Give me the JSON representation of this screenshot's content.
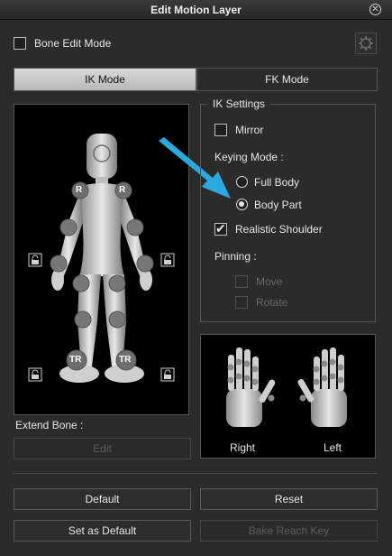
{
  "window": {
    "title": "Edit Motion Layer",
    "close_icon": "close-icon"
  },
  "bone_edit": {
    "label": "Bone Edit Mode",
    "checked": false,
    "settings_icon": "gear-icon"
  },
  "tabs": [
    {
      "label": "IK Mode",
      "active": true
    },
    {
      "label": "FK Mode",
      "active": false
    }
  ],
  "figure": {
    "joint_labels": {
      "shoulder": "R",
      "foot": "TR"
    },
    "pin_icon": "lock-icon"
  },
  "ik_settings": {
    "title": "IK Settings",
    "mirror": {
      "label": "Mirror",
      "checked": false
    },
    "keying_mode_label": "Keying Mode :",
    "keying_options": [
      {
        "label": "Full Body",
        "selected": false
      },
      {
        "label": "Body Part",
        "selected": true
      }
    ],
    "realistic_shoulder": {
      "label": "Realistic Shoulder",
      "checked": true
    },
    "pinning_label": "Pinning :",
    "pinning_options": [
      {
        "label": "Move",
        "enabled": false
      },
      {
        "label": "Rotate",
        "enabled": false
      }
    ]
  },
  "hands": {
    "right_label": "Right",
    "left_label": "Left"
  },
  "extend_bone": {
    "label": "Extend Bone :",
    "edit_label": "Edit"
  },
  "buttons": {
    "default": "Default",
    "reset": "Reset",
    "set_as_default": "Set as Default",
    "bake_reach_key": "Bake Reach Key"
  },
  "colors": {
    "accent_arrow": "#2ba8e0",
    "active_tab": "#c8c8c8",
    "background": "#2b2b2b"
  }
}
